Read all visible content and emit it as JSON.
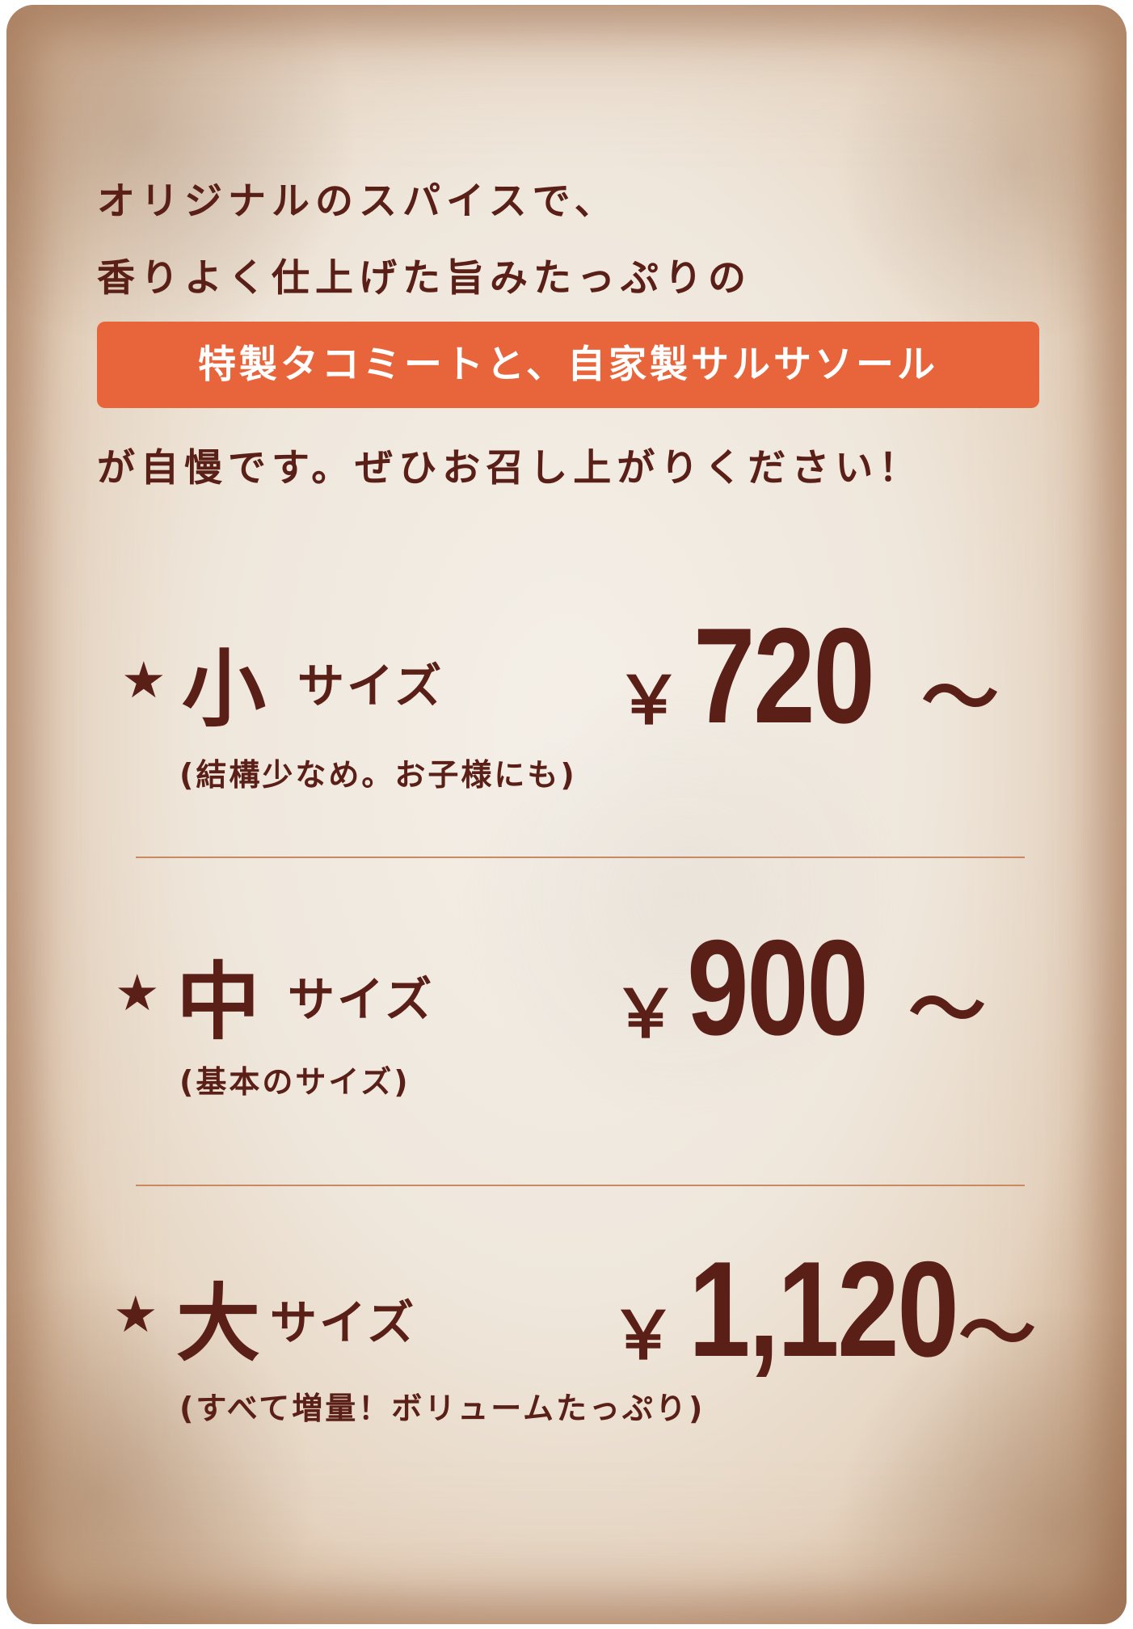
{
  "intro": {
    "line1": "オリジナルのスパイスで、",
    "line2": "香りよく仕上げた旨みたっぷりの",
    "highlight": "特製タコミートと、自家製サルサソール",
    "line3": "が自慢です。ぜひお召し上がりください！"
  },
  "sizes": [
    {
      "star": "★",
      "kanji": "小",
      "suffix": "サイズ",
      "note": "(結構少なめ。お子様にも)",
      "yen": "￥",
      "price": "720",
      "tilde": "～"
    },
    {
      "star": "★",
      "kanji": "中",
      "suffix": "サイズ",
      "note": "(基本のサイズ)",
      "yen": "￥",
      "price": "900",
      "tilde": "～"
    },
    {
      "star": "★",
      "kanji": "大",
      "suffix": "サイズ",
      "note": "(すべて増量！ボリュームたっぷり)",
      "yen": "￥",
      "price": "1,120",
      "tilde": "～"
    }
  ],
  "colors": {
    "text": "#5a1f17",
    "highlight_bg": "#e8643a",
    "highlight_text": "#ffffff",
    "divider": "#c98a62"
  }
}
